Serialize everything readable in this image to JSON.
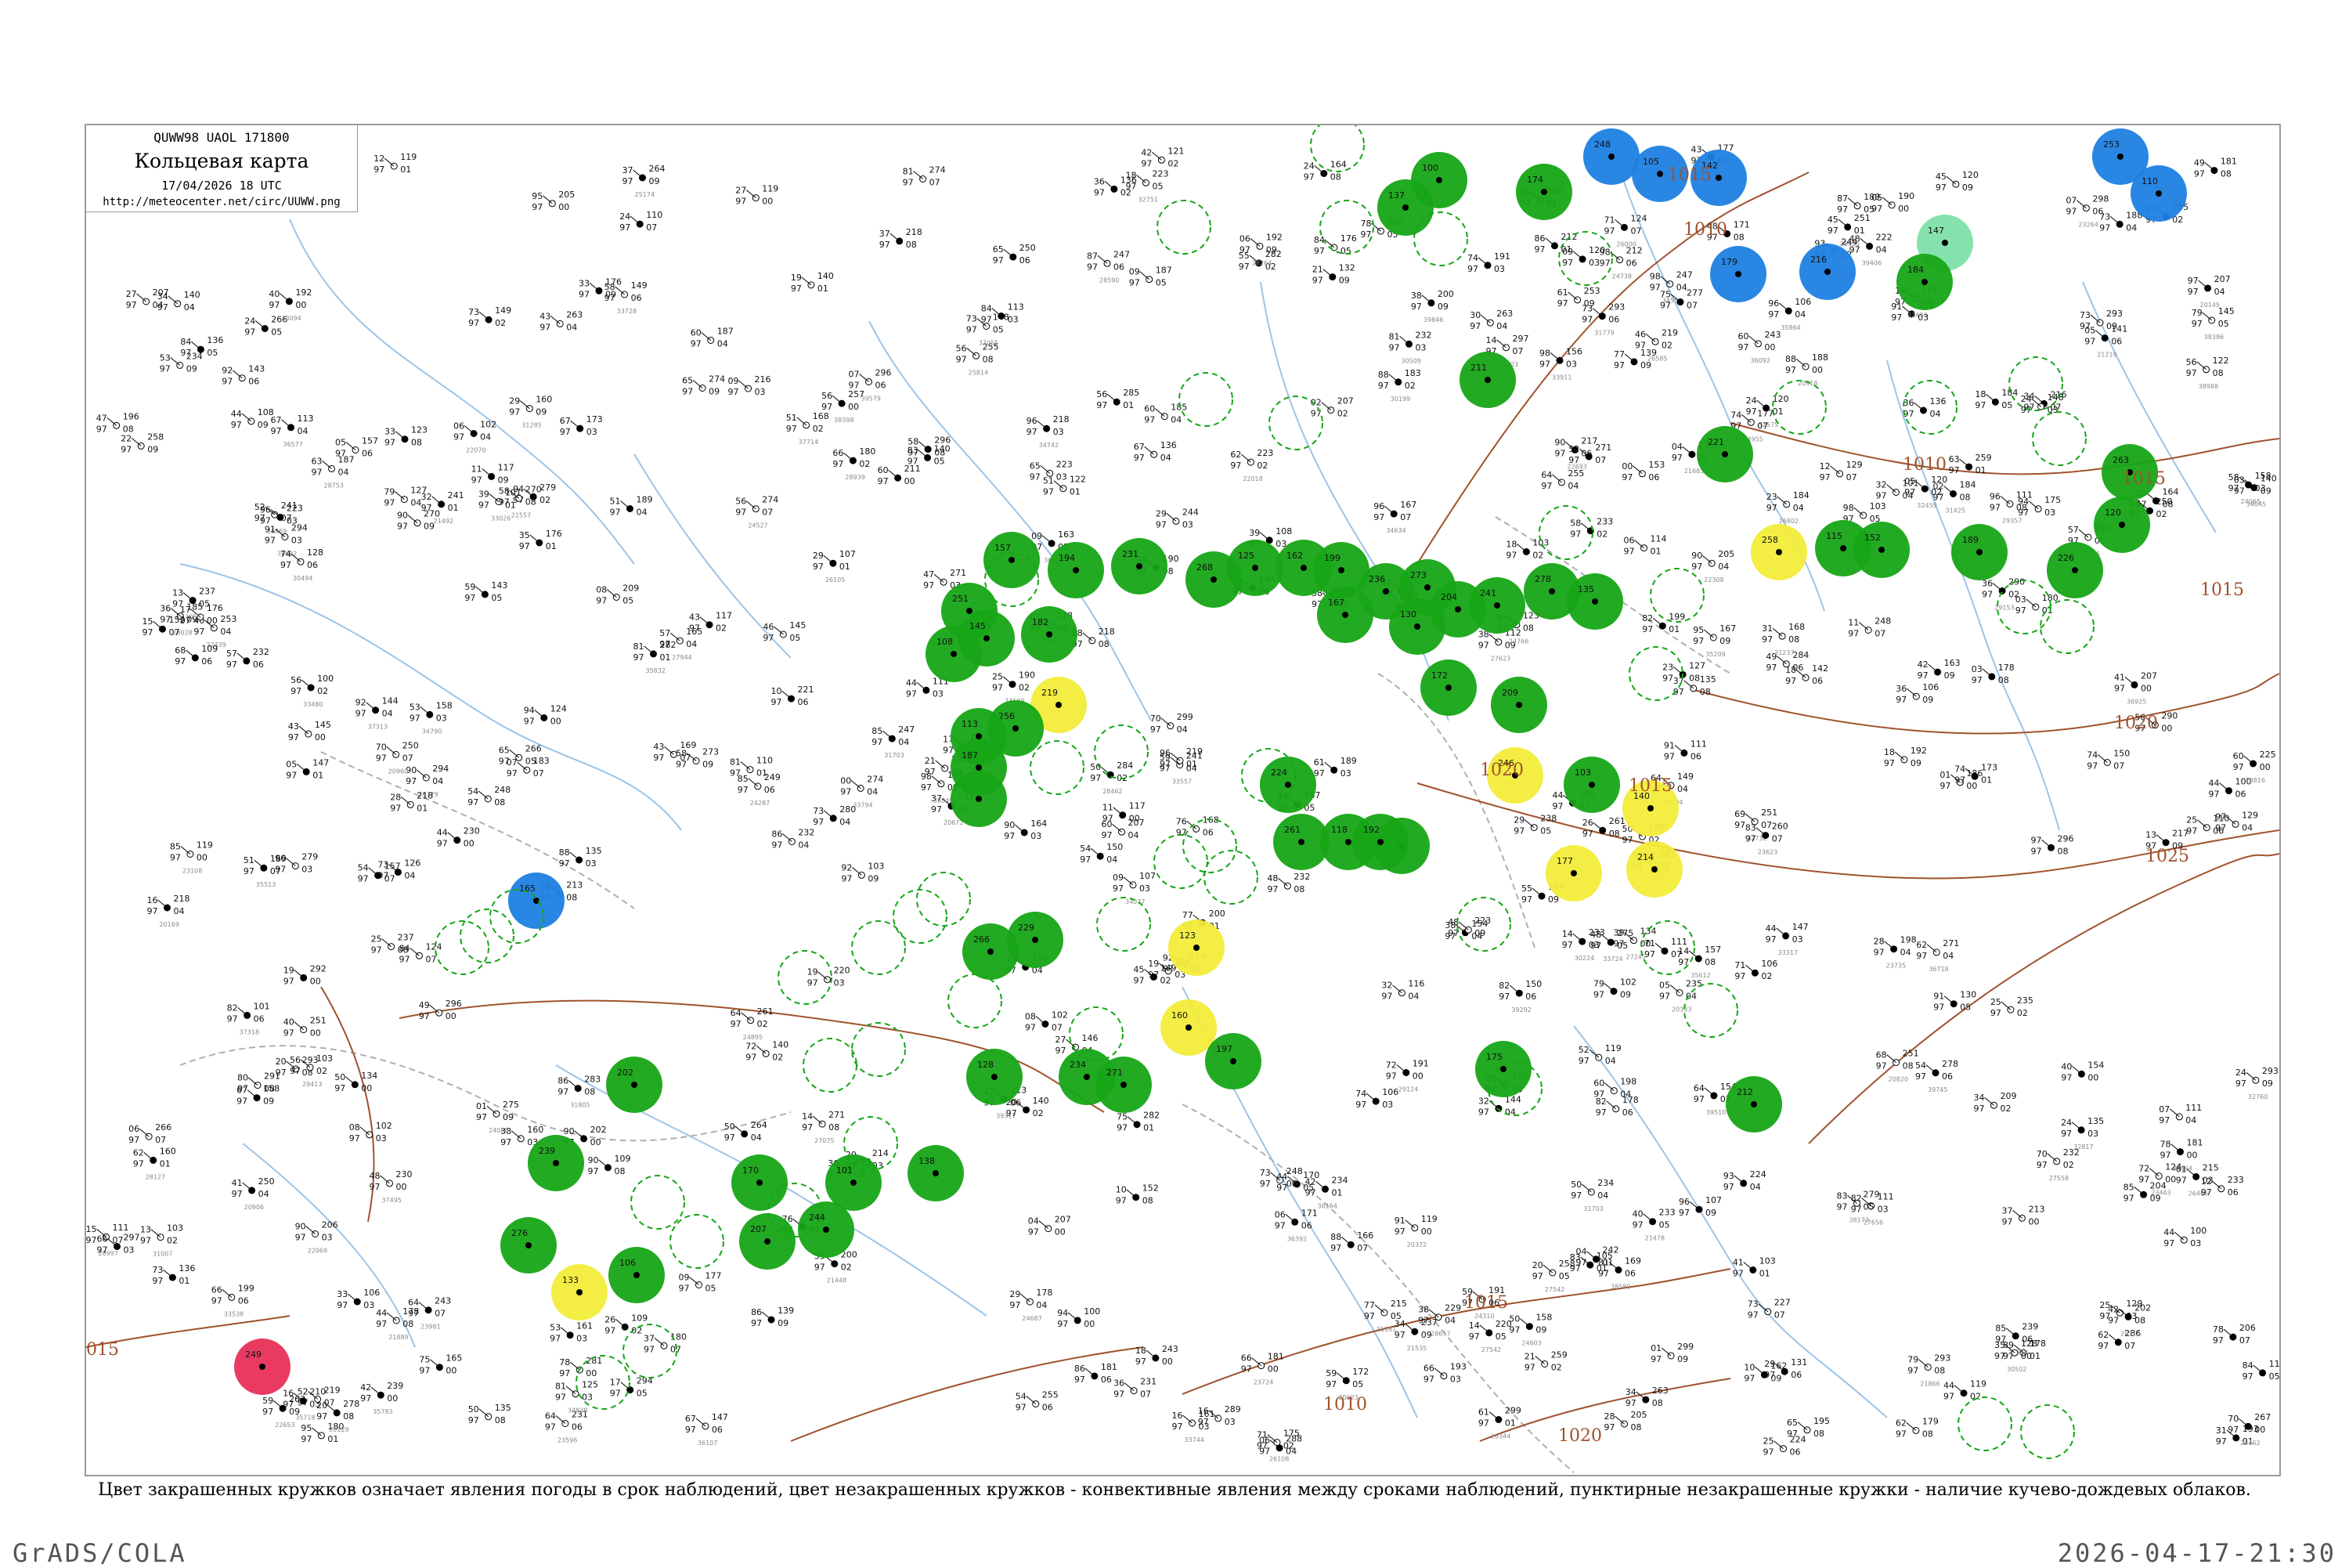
{
  "header": {
    "code": "QUWW98  UAOL  171800",
    "title": "Кольцевая карта",
    "time": "17/04/2026 18 UTC",
    "url": "http://meteocenter.net/circ/UUWW.png"
  },
  "caption": "Цвет закрашенных кружков означает явления погоды в срок наблюдений, цвет незакрашенных кружков - конвективные явления между сроками наблюдений, пунктирные незакрашенные кружки - наличие кучево-дождевых облаков.",
  "footer": {
    "left": "GrADS/COLA",
    "right": "2026-04-17-21:30"
  },
  "colors": {
    "precipitation": "#16a516",
    "shower": "#1e7fe0",
    "fog_haze": "#f2ec3a",
    "thunder": "#e8305a",
    "light_rain": "#7fe0a8",
    "isobar": "#a0522d",
    "river": "#9cc4e8",
    "border": "#b0b0b0"
  },
  "map": {
    "isobars": [
      {
        "label": "1010"
      },
      {
        "label": "1015"
      },
      {
        "label": "1020"
      },
      {
        "label": "1025"
      }
    ],
    "isobar_labels": [
      "1015",
      "1010",
      "1015",
      "1010",
      "1015",
      "1020",
      "1025",
      "1020",
      "1015",
      "1010",
      "1015",
      "1020",
      "015"
    ]
  }
}
